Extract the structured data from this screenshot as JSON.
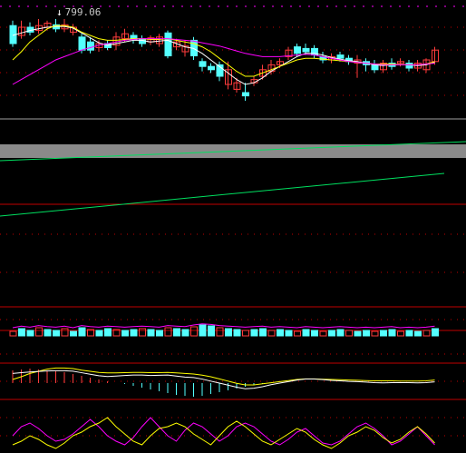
{
  "chart": {
    "price_label": "799.06",
    "price_marker": "↓",
    "colors": {
      "background": "#000000",
      "up": "#ff3c3c",
      "down": "#54ffff",
      "ma_short": "#ffffff",
      "ma_mid": "#ffff00",
      "ma_long": "#ff00ff",
      "trend_line": "#00e060",
      "separator": "#c00000",
      "grid_dotted": "#c00000"
    }
  },
  "chart_data": {
    "type": "candlestick",
    "title": "",
    "series": [
      {
        "name": "price",
        "values": [
          {
            "o": 18,
            "c": 40,
            "h": 12,
            "l": 44
          },
          {
            "o": 30,
            "c": 20,
            "h": 12,
            "l": 34
          },
          {
            "o": 20,
            "c": 26,
            "h": 14,
            "l": 30
          },
          {
            "o": 24,
            "c": 18,
            "h": 10,
            "l": 28
          },
          {
            "o": 20,
            "c": 15,
            "h": 12,
            "l": 24
          },
          {
            "o": 17,
            "c": 22,
            "h": 10,
            "l": 26
          },
          {
            "o": 22,
            "c": 17,
            "h": 10,
            "l": 26
          },
          {
            "o": 26,
            "c": 20,
            "h": 16,
            "l": 30
          },
          {
            "o": 32,
            "c": 48,
            "h": 28,
            "l": 52
          },
          {
            "o": 38,
            "c": 48,
            "h": 32,
            "l": 52
          },
          {
            "o": 45,
            "c": 40,
            "h": 36,
            "l": 50
          },
          {
            "o": 40,
            "c": 45,
            "h": 36,
            "l": 48
          },
          {
            "o": 42,
            "c": 32,
            "h": 26,
            "l": 48
          },
          {
            "o": 34,
            "c": 28,
            "h": 22,
            "l": 38
          },
          {
            "o": 30,
            "c": 35,
            "h": 26,
            "l": 40
          },
          {
            "o": 34,
            "c": 40,
            "h": 30,
            "l": 44
          },
          {
            "o": 38,
            "c": 33,
            "h": 30,
            "l": 42
          },
          {
            "o": 40,
            "c": 32,
            "h": 28,
            "l": 44
          },
          {
            "o": 27,
            "c": 55,
            "h": 24,
            "l": 58
          },
          {
            "o": 44,
            "c": 38,
            "h": 34,
            "l": 48
          },
          {
            "o": 50,
            "c": 43,
            "h": 36,
            "l": 56
          },
          {
            "o": 36,
            "c": 55,
            "h": 32,
            "l": 60
          },
          {
            "o": 62,
            "c": 68,
            "h": 58,
            "l": 74
          },
          {
            "o": 68,
            "c": 72,
            "h": 64,
            "l": 76
          },
          {
            "o": 66,
            "c": 80,
            "h": 62,
            "l": 86
          },
          {
            "o": 90,
            "c": 72,
            "h": 62,
            "l": 96
          },
          {
            "o": 96,
            "c": 88,
            "h": 82,
            "l": 100
          },
          {
            "o": 100,
            "c": 104,
            "h": 88,
            "l": 110
          },
          {
            "o": 88,
            "c": 84,
            "h": 80,
            "l": 92
          },
          {
            "o": 80,
            "c": 72,
            "h": 66,
            "l": 84
          },
          {
            "o": 74,
            "c": 66,
            "h": 60,
            "l": 78
          },
          {
            "o": 66,
            "c": 62,
            "h": 58,
            "l": 70
          },
          {
            "o": 56,
            "c": 48,
            "h": 44,
            "l": 60
          },
          {
            "o": 44,
            "c": 52,
            "h": 40,
            "l": 56
          },
          {
            "o": 46,
            "c": 50,
            "h": 40,
            "l": 54
          },
          {
            "o": 46,
            "c": 54,
            "h": 42,
            "l": 58
          },
          {
            "o": 56,
            "c": 60,
            "h": 50,
            "l": 64
          },
          {
            "o": 60,
            "c": 56,
            "h": 52,
            "l": 64
          },
          {
            "o": 54,
            "c": 58,
            "h": 50,
            "l": 62
          },
          {
            "o": 58,
            "c": 62,
            "h": 54,
            "l": 66
          },
          {
            "o": 64,
            "c": 60,
            "h": 54,
            "l": 82
          },
          {
            "o": 62,
            "c": 66,
            "h": 58,
            "l": 74
          },
          {
            "o": 66,
            "c": 72,
            "h": 60,
            "l": 76
          },
          {
            "o": 72,
            "c": 64,
            "h": 60,
            "l": 76
          },
          {
            "o": 64,
            "c": 68,
            "h": 58,
            "l": 72
          },
          {
            "o": 64,
            "c": 62,
            "h": 58,
            "l": 68
          },
          {
            "o": 64,
            "c": 70,
            "h": 60,
            "l": 74
          },
          {
            "o": 70,
            "c": 64,
            "h": 60,
            "l": 74
          },
          {
            "o": 72,
            "c": 60,
            "h": 58,
            "l": 76
          },
          {
            "o": 62,
            "c": 48,
            "h": 44,
            "l": 66
          }
        ]
      }
    ],
    "ma_short": [
      30,
      27,
      24,
      22,
      20,
      19,
      19,
      21,
      27,
      33,
      39,
      42,
      40,
      38,
      36,
      36,
      38,
      37,
      36,
      40,
      44,
      46,
      52,
      60,
      68,
      76,
      84,
      90,
      88,
      82,
      74,
      68,
      62,
      56,
      52,
      52,
      54,
      57,
      59,
      61,
      62,
      64,
      66,
      67,
      66,
      66,
      66,
      67,
      66,
      63
    ],
    "ma_long": [
      90,
      84,
      78,
      72,
      66,
      60,
      56,
      52,
      48,
      45,
      42,
      40,
      38,
      36,
      35,
      34,
      34,
      34,
      34,
      35,
      36,
      37,
      39,
      41,
      43,
      46,
      49,
      52,
      54,
      56,
      56,
      56,
      55,
      54,
      53,
      54,
      56,
      58,
      60,
      62,
      63,
      64,
      65,
      66,
      66,
      66,
      66,
      66,
      65,
      64
    ],
    "ma_mid": [
      60,
      50,
      38,
      30,
      22,
      18,
      18,
      20,
      26,
      30,
      34,
      36,
      36,
      35,
      34,
      34,
      35,
      35,
      34,
      36,
      38,
      40,
      44,
      50,
      58,
      66,
      74,
      80,
      80,
      76,
      72,
      68,
      64,
      60,
      58,
      58,
      59,
      60,
      61,
      62,
      63,
      64,
      65,
      65,
      65,
      66,
      66,
      66,
      65,
      62
    ],
    "volume": [
      5,
      8,
      6,
      9,
      7,
      6,
      8,
      5,
      9,
      7,
      6,
      8,
      7,
      6,
      7,
      8,
      7,
      6,
      9,
      8,
      7,
      10,
      12,
      11,
      9,
      8,
      7,
      6,
      7,
      8,
      6,
      7,
      6,
      5,
      7,
      6,
      5,
      6,
      7,
      6,
      5,
      6,
      5,
      6,
      7,
      5,
      6,
      5,
      6,
      8
    ],
    "macd_hist": [
      14,
      15,
      16,
      15,
      14,
      13,
      12,
      10,
      8,
      6,
      4,
      2,
      0,
      -1,
      -3,
      -5,
      -7,
      -9,
      -11,
      -13,
      -14,
      -15,
      -14,
      -12,
      -10,
      -8,
      -6,
      -4,
      -2,
      -1,
      0,
      0,
      0,
      0,
      0,
      0,
      0,
      0,
      0,
      0,
      0,
      0,
      0,
      0,
      0,
      0,
      0,
      0,
      0,
      0
    ]
  }
}
